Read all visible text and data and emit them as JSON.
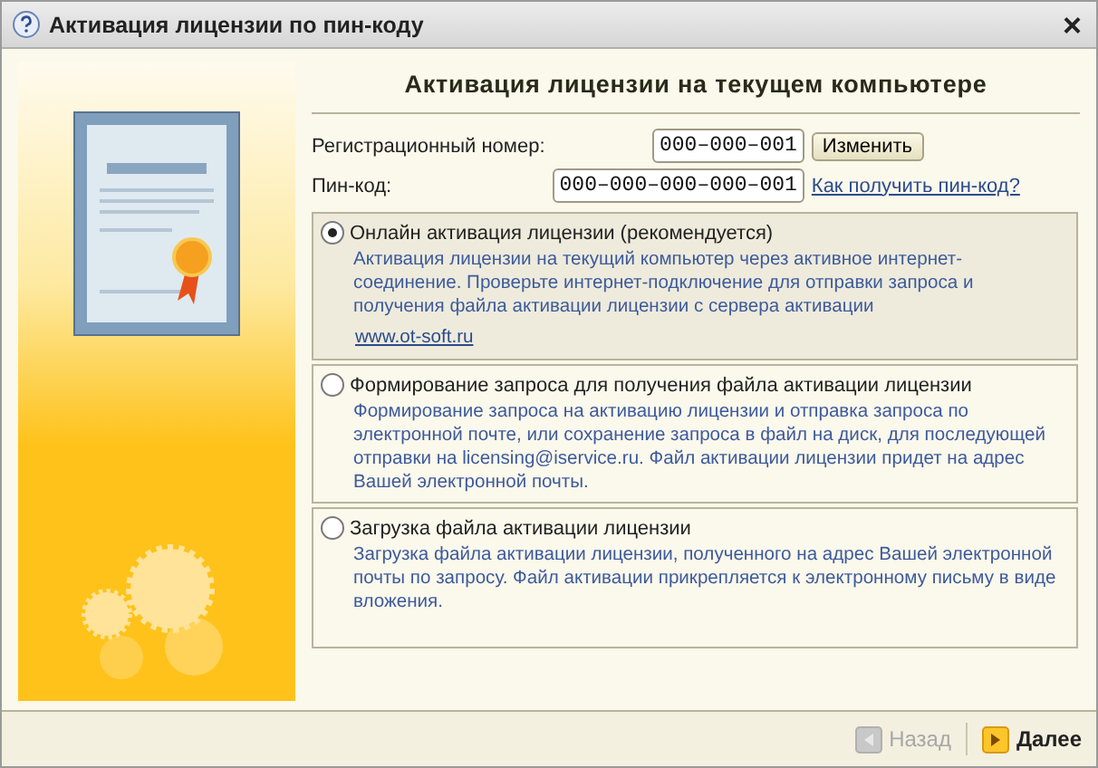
{
  "window": {
    "title": "Активация лицензии по пин-коду",
    "close": "×"
  },
  "heading": "Активация лицензии на текущем компьютере",
  "registration": {
    "label": "Регистрационный номер:",
    "value": "000–000–001",
    "button": "Изменить"
  },
  "pin": {
    "label": "Пин-код:",
    "value": "000–000–000–000–001",
    "link": "Как получить пин-код?"
  },
  "options": [
    {
      "label": "Онлайн активация лицензии (рекомендуется)",
      "selected": true,
      "description": "Активация лицензии на текущий компьютер через активное интернет-соединение. Проверьте интернет-подключение для отправки запроса и получения файла активации лицензии с сервера активации",
      "link": "www.ot-soft.ru"
    },
    {
      "label": "Формирование запроса для получения файла активации лицензии",
      "selected": false,
      "description": "Формирование запроса на активацию лицензии и отправка запроса по электронной почте, или сохранение запроса в файл на диск, для последующей отправки на licensing@iservice.ru. Файл активации лицензии придет на адрес Вашей электронной почты."
    },
    {
      "label": "Загрузка файла активации лицензии",
      "selected": false,
      "description": "Загрузка файла активации лицензии, полученного на адрес Вашей электронной почты по запросу. Файл активации прикрепляется к электронному письму в виде вложения."
    }
  ],
  "footer": {
    "back": {
      "label": "Назад",
      "disabled": true
    },
    "next": {
      "label": "Далее",
      "disabled": false
    }
  }
}
